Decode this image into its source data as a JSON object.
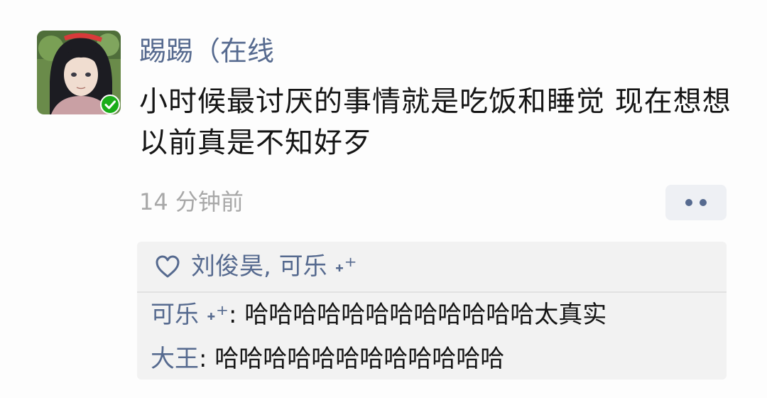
{
  "post": {
    "username": "踢踢（在线",
    "content": "小时候最讨厌的事情就是吃饭和睡觉 现在想想以前真是不知好歹",
    "timestamp": "14 分钟前"
  },
  "likes": {
    "names": "刘俊昊, 可乐 ˖⁺"
  },
  "comments": [
    {
      "author": "可乐 ˖⁺",
      "separator": ": ",
      "text": "哈哈哈哈哈哈哈哈哈哈哈哈太真实"
    },
    {
      "author": "大王",
      "separator": ": ",
      "text": "哈哈哈哈哈哈哈哈哈哈哈哈"
    }
  ],
  "colors": {
    "name_link": "#566a8f",
    "verified_badge": "#1aad19",
    "timestamp": "#a8a8a8"
  },
  "icons": {
    "avatar": "anime-character-avatar",
    "verified": "verified-check-icon",
    "more": "more-dots-icon",
    "like": "heart-icon"
  }
}
